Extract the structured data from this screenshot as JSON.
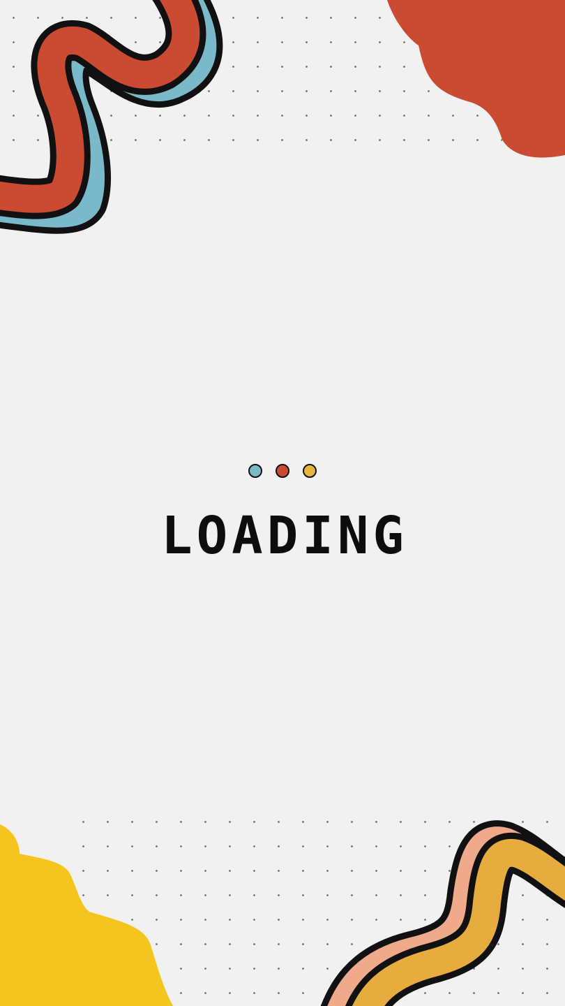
{
  "loading": {
    "label": "LOADING",
    "dots": [
      {
        "name": "blue",
        "color": "#7ab9c9"
      },
      {
        "name": "red",
        "color": "#cb4b32"
      },
      {
        "name": "yellow",
        "color": "#e7b43d"
      }
    ]
  },
  "colors": {
    "background": "#f1f1f1",
    "outline": "#111111",
    "red": "#cb4b32",
    "blue": "#7ab9c9",
    "yellow": "#f4c51f",
    "orange": "#e6ad3e",
    "peach": "#eeaa8a"
  }
}
